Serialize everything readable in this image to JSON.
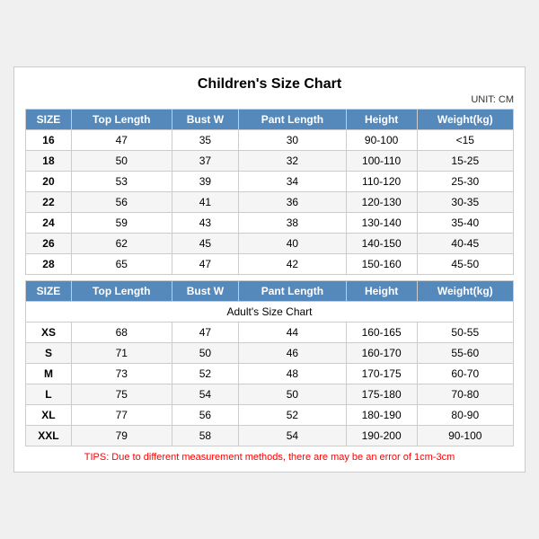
{
  "title": "Children's Size Chart",
  "unit": "UNIT: CM",
  "children": {
    "headers": [
      "SIZE",
      "Top Length",
      "Bust W",
      "Pant Length",
      "Height",
      "Weight(kg)"
    ],
    "rows": [
      [
        "16",
        "47",
        "35",
        "30",
        "90-100",
        "<15"
      ],
      [
        "18",
        "50",
        "37",
        "32",
        "100-110",
        "15-25"
      ],
      [
        "20",
        "53",
        "39",
        "34",
        "110-120",
        "25-30"
      ],
      [
        "22",
        "56",
        "41",
        "36",
        "120-130",
        "30-35"
      ],
      [
        "24",
        "59",
        "43",
        "38",
        "130-140",
        "35-40"
      ],
      [
        "26",
        "62",
        "45",
        "40",
        "140-150",
        "40-45"
      ],
      [
        "28",
        "65",
        "47",
        "42",
        "150-160",
        "45-50"
      ]
    ]
  },
  "adults": {
    "title": "Adult's Size Chart",
    "headers": [
      "SIZE",
      "Top Length",
      "Bust W",
      "Pant Length",
      "Height",
      "Weight(kg)"
    ],
    "rows": [
      [
        "XS",
        "68",
        "47",
        "44",
        "160-165",
        "50-55"
      ],
      [
        "S",
        "71",
        "50",
        "46",
        "160-170",
        "55-60"
      ],
      [
        "M",
        "73",
        "52",
        "48",
        "170-175",
        "60-70"
      ],
      [
        "L",
        "75",
        "54",
        "50",
        "175-180",
        "70-80"
      ],
      [
        "XL",
        "77",
        "56",
        "52",
        "180-190",
        "80-90"
      ],
      [
        "XXL",
        "79",
        "58",
        "54",
        "190-200",
        "90-100"
      ]
    ]
  },
  "tips": "TIPS: Due to different measurement methods, there are may be an error of 1cm-3cm"
}
